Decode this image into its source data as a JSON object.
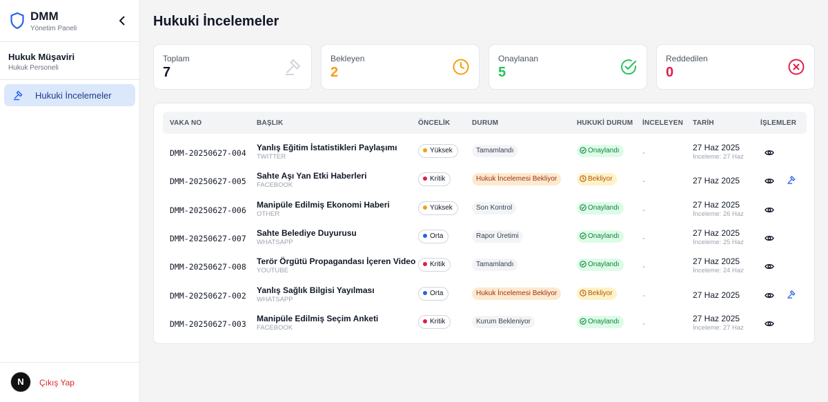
{
  "brand": {
    "title": "DMM",
    "subtitle": "Yönetim Paneli"
  },
  "user": {
    "name": "Hukuk Müşaviri",
    "role": "Hukuk Personeli"
  },
  "nav": [
    {
      "label": "Hukuki İncelemeler",
      "active": true
    }
  ],
  "footer": {
    "avatar_letter": "N",
    "logout_label": "Çıkış Yap"
  },
  "page": {
    "title": "Hukuki İncelemeler"
  },
  "stats": [
    {
      "label": "Toplam",
      "value": "7",
      "color": "#111827",
      "icon": "gavel-icon"
    },
    {
      "label": "Bekleyen",
      "value": "2",
      "color": "#f59e0b",
      "icon": "clock-icon"
    },
    {
      "label": "Onaylanan",
      "value": "5",
      "color": "#22c55e",
      "icon": "check-circle-icon"
    },
    {
      "label": "Reddedilen",
      "value": "0",
      "color": "#e11d48",
      "icon": "x-circle-icon"
    }
  ],
  "table": {
    "headers": [
      "VAKA NO",
      "BAŞLIK",
      "ÖNCELİK",
      "DURUM",
      "HUKUKİ DURUM",
      "İNCELEYEN",
      "TARİH",
      "İŞLEMLER"
    ],
    "rows": [
      {
        "case_no": "DMM-20250627-004",
        "title": "Yanlış Eğitim İstatistikleri Paylaşımı",
        "platform": "TWITTER",
        "priority": "Yüksek",
        "priority_color": "#f59e0b",
        "status": "Tamamlandı",
        "status_kind": "gray",
        "legal_status": "Onaylandı",
        "legal_kind": "approved",
        "reviewer": "-",
        "date": "27 Haz 2025",
        "review_date": "İnceleme: 27 Haz",
        "can_review": false
      },
      {
        "case_no": "DMM-20250627-005",
        "title": "Sahte Aşı Yan Etki Haberleri",
        "platform": "FACEBOOK",
        "priority": "Kritik",
        "priority_color": "#e11d48",
        "status": "Hukuk İncelemesi Bekliyor",
        "status_kind": "orange",
        "legal_status": "Bekliyor",
        "legal_kind": "pending",
        "reviewer": "-",
        "date": "27 Haz 2025",
        "review_date": "",
        "can_review": true
      },
      {
        "case_no": "DMM-20250627-006",
        "title": "Manipüle Edilmiş Ekonomi Haberi",
        "platform": "OTHER",
        "priority": "Yüksek",
        "priority_color": "#f59e0b",
        "status": "Son Kontrol",
        "status_kind": "gray",
        "legal_status": "Onaylandı",
        "legal_kind": "approved",
        "reviewer": "-",
        "date": "27 Haz 2025",
        "review_date": "İnceleme: 26 Haz",
        "can_review": false
      },
      {
        "case_no": "DMM-20250627-007",
        "title": "Sahte Belediye Duyurusu",
        "platform": "WHATSAPP",
        "priority": "Orta",
        "priority_color": "#2563eb",
        "status": "Rapor Üretimi",
        "status_kind": "gray",
        "legal_status": "Onaylandı",
        "legal_kind": "approved",
        "reviewer": "-",
        "date": "27 Haz 2025",
        "review_date": "İnceleme: 25 Haz",
        "can_review": false
      },
      {
        "case_no": "DMM-20250627-008",
        "title": "Terör Örgütü Propagandası İçeren Video",
        "platform": "YOUTUBE",
        "priority": "Kritik",
        "priority_color": "#e11d48",
        "status": "Tamamlandı",
        "status_kind": "gray",
        "legal_status": "Onaylandı",
        "legal_kind": "approved",
        "reviewer": "-",
        "date": "27 Haz 2025",
        "review_date": "İnceleme: 24 Haz",
        "can_review": false
      },
      {
        "case_no": "DMM-20250627-002",
        "title": "Yanlış Sağlık Bilgisi Yayılması",
        "platform": "WHATSAPP",
        "priority": "Orta",
        "priority_color": "#2563eb",
        "status": "Hukuk İncelemesi Bekliyor",
        "status_kind": "orange",
        "legal_status": "Bekliyor",
        "legal_kind": "pending",
        "reviewer": "-",
        "date": "27 Haz 2025",
        "review_date": "",
        "can_review": true
      },
      {
        "case_no": "DMM-20250627-003",
        "title": "Manipüle Edilmiş Seçim Anketi",
        "platform": "FACEBOOK",
        "priority": "Kritik",
        "priority_color": "#e11d48",
        "status": "Kurum Bekleniyor",
        "status_kind": "gray",
        "legal_status": "Onaylandı",
        "legal_kind": "approved",
        "reviewer": "-",
        "date": "27 Haz 2025",
        "review_date": "İnceleme: 27 Haz",
        "can_review": false
      }
    ]
  },
  "colors": {
    "accent": "#2563eb",
    "approved_bg": "#dcfce7",
    "approved_fg": "#15803d",
    "pending_bg": "#fef3c7",
    "pending_fg": "#b45309"
  }
}
